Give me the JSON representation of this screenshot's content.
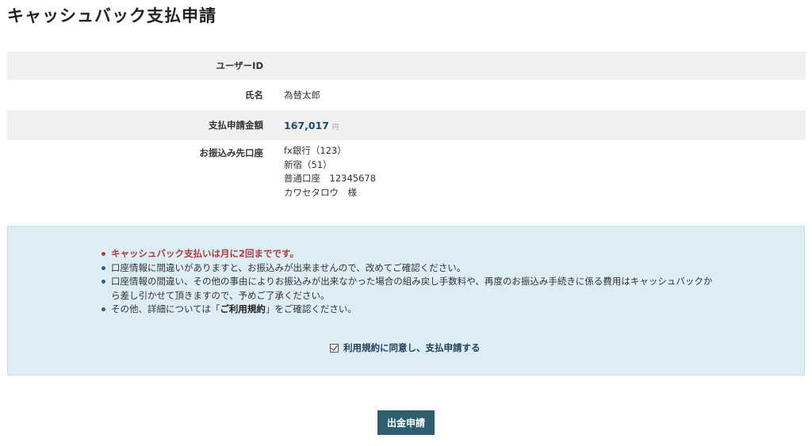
{
  "page": {
    "title": "キャッシュバック支払申請"
  },
  "info": {
    "user_id": {
      "label": "ユーザーID",
      "value": ""
    },
    "name": {
      "label": "氏名",
      "value": "為替太郎"
    },
    "amount": {
      "label": "支払申請金額",
      "value": "167,017",
      "unit": "円"
    },
    "account": {
      "label": "お振込み先口座",
      "lines": [
        "fx銀行（123）",
        "新宿（51）",
        "普通口座　12345678",
        "カワセタロウ　様"
      ]
    }
  },
  "notice": {
    "items": [
      "キャッシュバック支払いは月に2回までです。",
      "口座情報に間違いがありますと、お振込みが出来ませんので、改めてご確認ください。",
      "口座情報の間違い、その他の事由によりお振込みが出来なかった場合の組み戻し手数料や、再度のお振込み手続きに係る費用はキャッシュバックから差し引かせて頂きますので、予めご了承ください。"
    ],
    "terms_prefix": "その他、詳細については「",
    "terms_link": "ご利用規約",
    "terms_suffix": "」をご確認ください。",
    "agree_label": "利用規約に同意し、支払申請する",
    "agree_checked": true
  },
  "actions": {
    "submit_label": "出金申請"
  }
}
